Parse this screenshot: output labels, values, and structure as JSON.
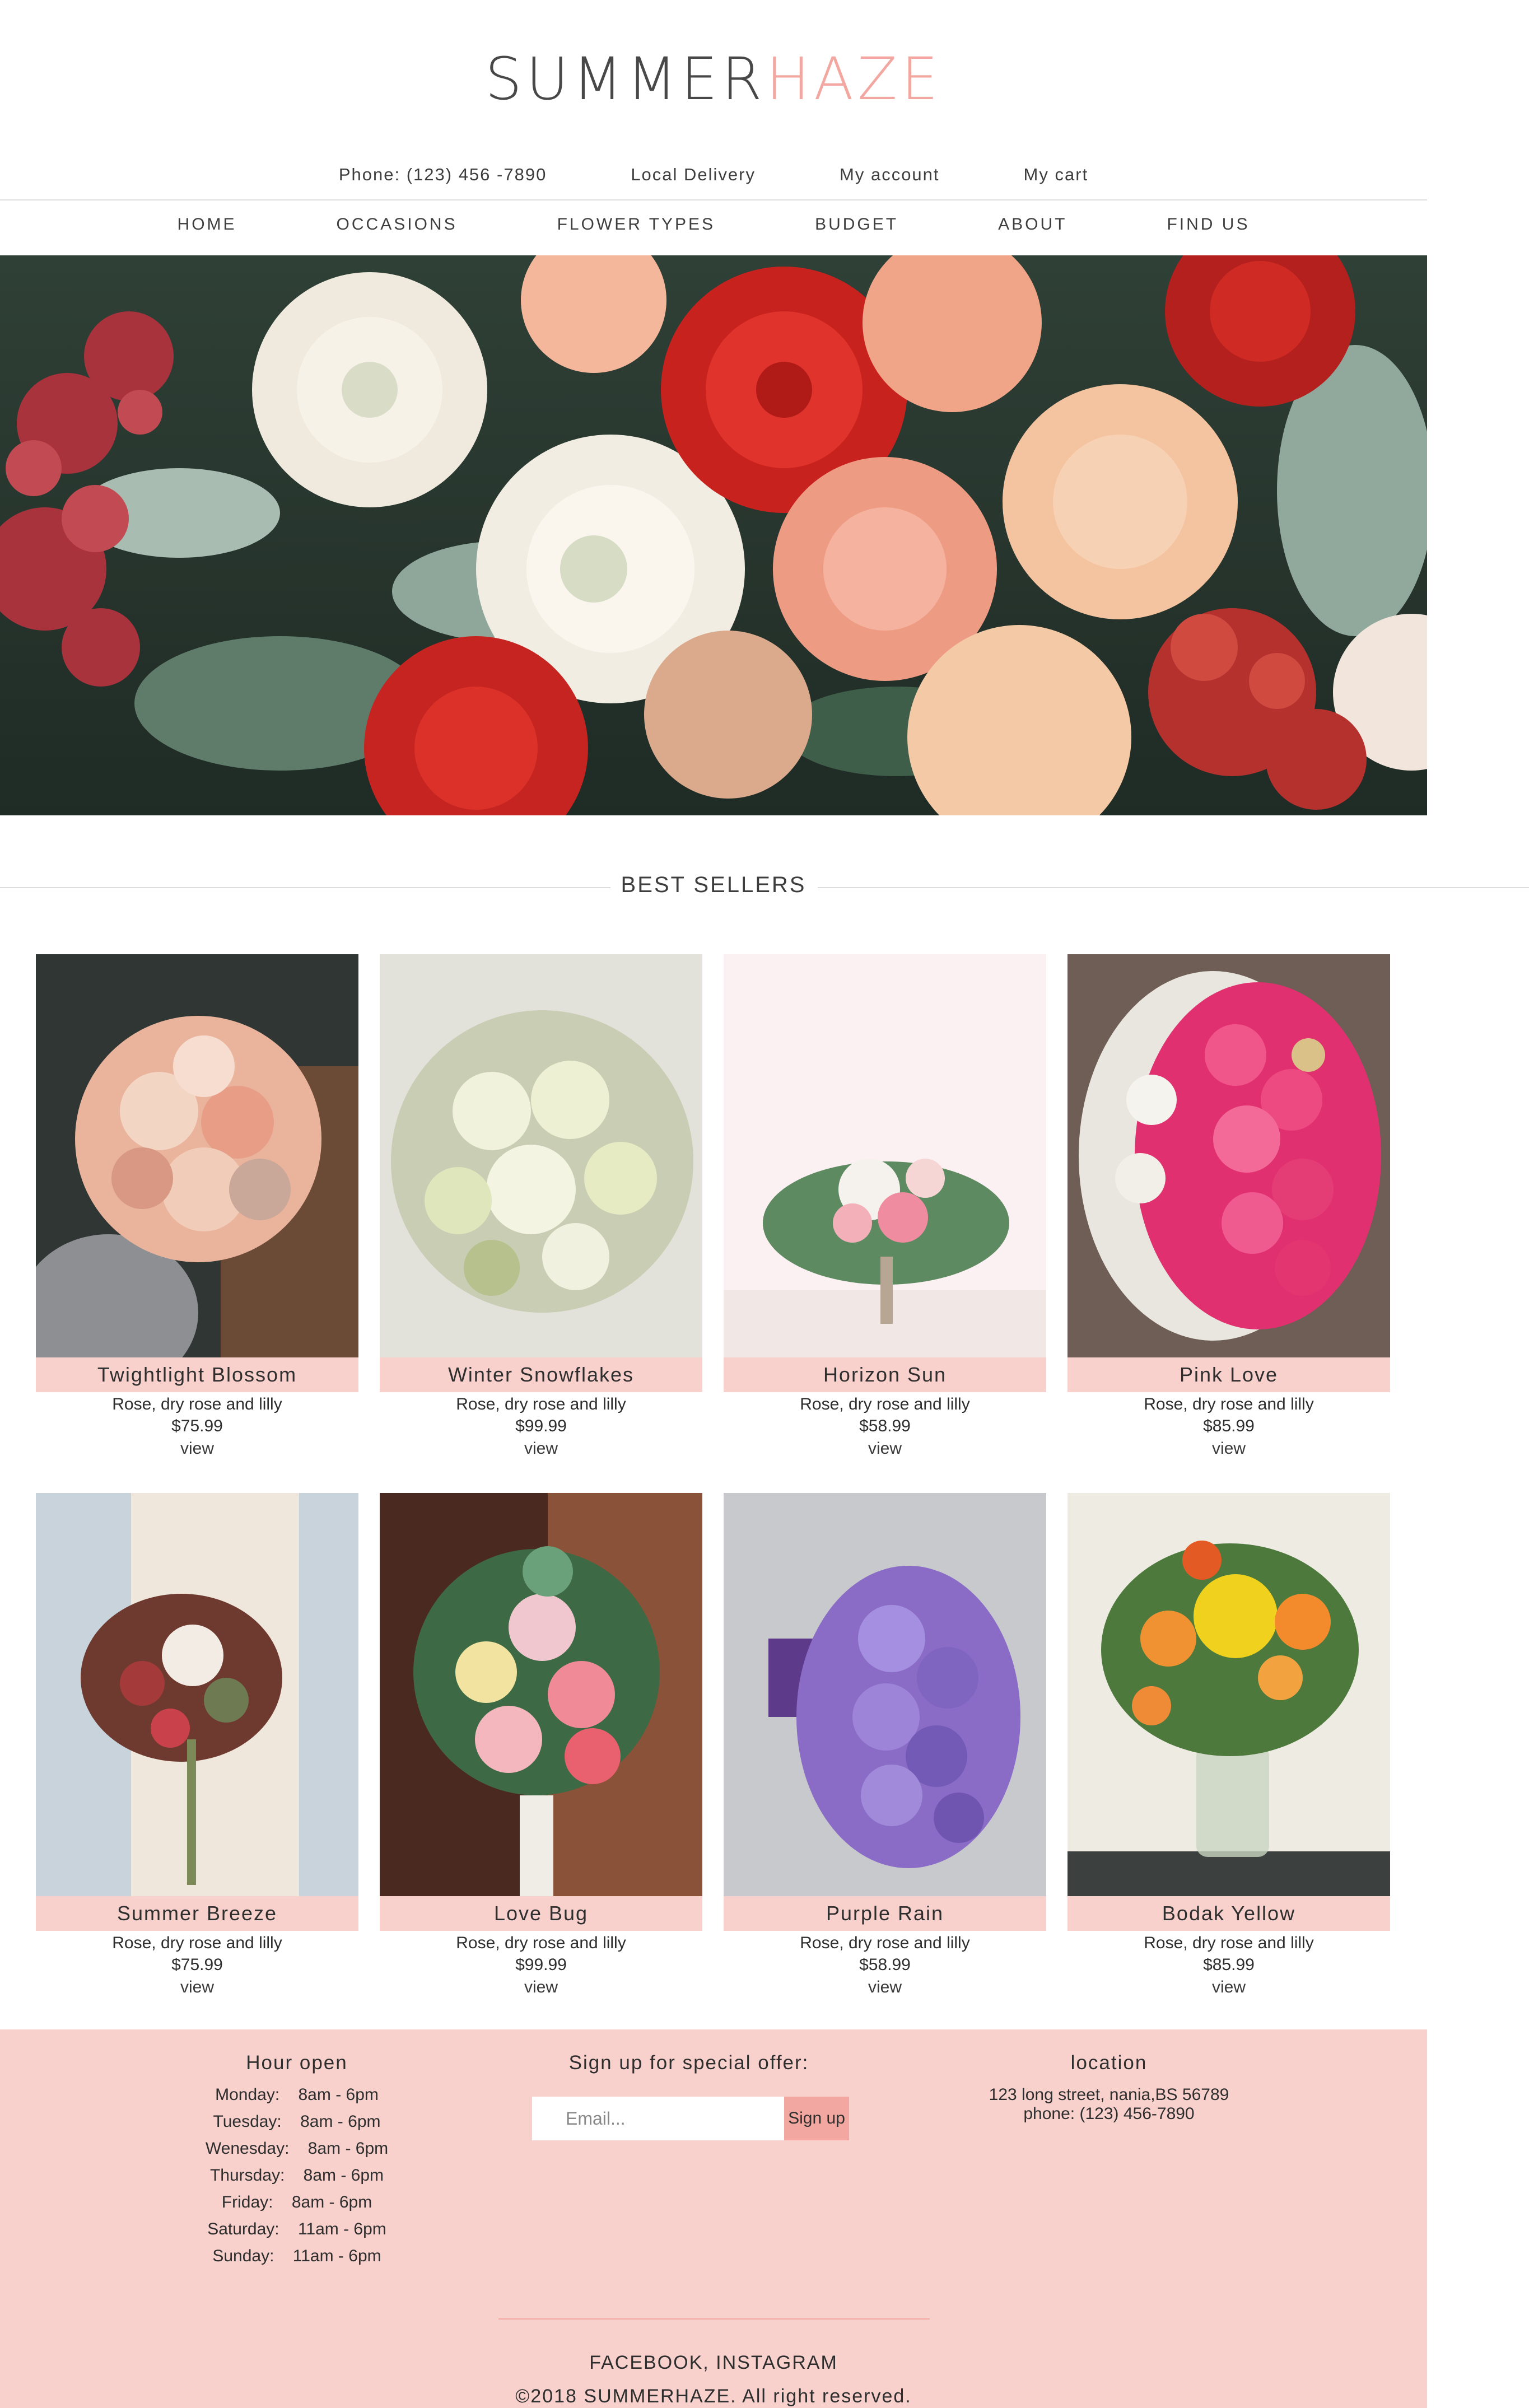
{
  "brand": {
    "name_part1": "SUMMER",
    "name_part2": "HAZE",
    "accent_color": "#f2a8a0",
    "pink_light": "#f8d1cd"
  },
  "topbar": {
    "phone": "Phone: (123) 456 -7890",
    "delivery": "Local Delivery",
    "account": "My account",
    "cart": "My cart"
  },
  "nav": {
    "items": [
      "HOME",
      "OCCASIONS",
      "FLOWER TYPES",
      "BUDGET",
      "ABOUT",
      "FIND US"
    ]
  },
  "hero": {
    "image": "photo of mixed flower bouquet: white ranunculus, red garden roses, peach carnations, red berries, eucalyptus"
  },
  "best_sellers": {
    "title": "BEST SELLERS",
    "products": [
      {
        "name": "Twightlight Blossom",
        "desc": "Rose, dry rose and lilly",
        "price": "$75.99",
        "link": "view"
      },
      {
        "name": "Winter Snowflakes",
        "desc": "Rose, dry rose and lilly",
        "price": "$99.99",
        "link": "view"
      },
      {
        "name": "Horizon Sun",
        "desc": "Rose, dry rose and lilly",
        "price": "$58.99",
        "link": "view"
      },
      {
        "name": "Pink Love",
        "desc": "Rose, dry rose and lilly",
        "price": "$85.99",
        "link": "view"
      },
      {
        "name": "Summer Breeze",
        "desc": "Rose, dry rose and lilly",
        "price": "$75.99",
        "link": "view"
      },
      {
        "name": "Love Bug",
        "desc": "Rose, dry rose and lilly",
        "price": "$99.99",
        "link": "view"
      },
      {
        "name": "Purple Rain",
        "desc": "Rose, dry rose and lilly",
        "price": "$58.99",
        "link": "view"
      },
      {
        "name": "Bodak Yellow",
        "desc": "Rose, dry rose and lilly",
        "price": "$85.99",
        "link": "view"
      }
    ]
  },
  "footer": {
    "hours_title": "Hour open",
    "hours": [
      "Monday:    8am - 6pm",
      "Tuesday:    8am - 6pm",
      "Wenesday:    8am - 6pm",
      "Thursday:    8am - 6pm",
      "Friday:    8am - 6pm",
      "Saturday:    11am - 6pm",
      "Sunday:    11am - 6pm"
    ],
    "signup_title": "Sign up for special offer:",
    "email_placeholder": "Email...",
    "signup_button": "Sign up",
    "location_title": "location",
    "address": "123 long street, nania,BS 56789",
    "phone": "phone: (123) 456-7890",
    "social": "FACEBOOK, INSTAGRAM",
    "copyright": "©2018 SUMMERHAZE. All right reserved."
  }
}
